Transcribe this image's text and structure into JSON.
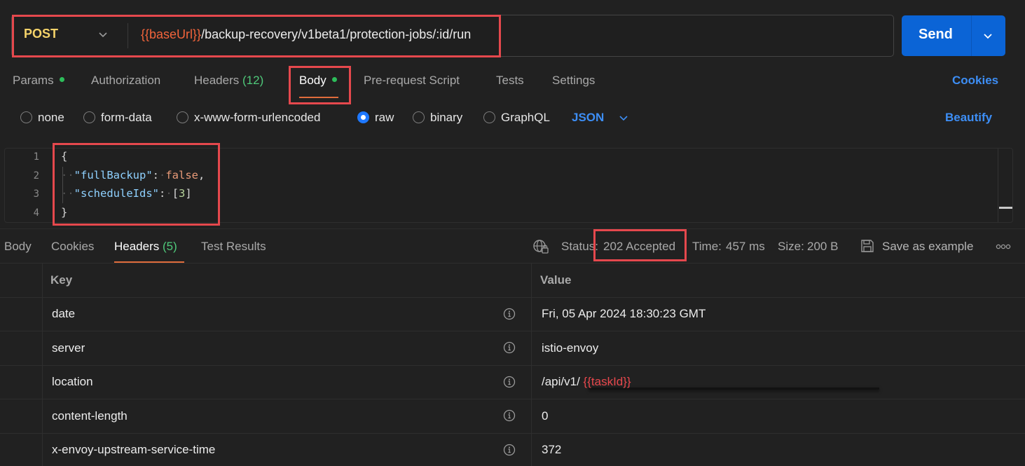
{
  "request": {
    "method": "POST",
    "url_variable": "{{baseUrl}}",
    "url_path": "/backup-recovery/v1beta1/protection-jobs/:id/run",
    "send_label": "Send"
  },
  "request_tabs": [
    {
      "label": "Params",
      "dot": true
    },
    {
      "label": "Authorization"
    },
    {
      "label": "Headers",
      "count": "(12)"
    },
    {
      "label": "Body",
      "dot": true,
      "active": true
    },
    {
      "label": "Pre-request Script"
    },
    {
      "label": "Tests"
    },
    {
      "label": "Settings"
    }
  ],
  "cookies_label": "Cookies",
  "body_modes": {
    "options": [
      "none",
      "form-data",
      "x-www-form-urlencoded",
      "raw",
      "binary",
      "GraphQL"
    ],
    "selected": "raw",
    "format": "JSON",
    "beautify_label": "Beautify"
  },
  "editor": {
    "line_numbers": [
      "1",
      "2",
      "3",
      "4"
    ],
    "lines": {
      "open": "{",
      "key1": "\"fullBackup\"",
      "val1": "false",
      "key2": "\"scheduleIds\"",
      "val2_open": "[",
      "val2_num": "3",
      "val2_close": "]",
      "close": "}"
    }
  },
  "response_tabs": [
    {
      "label": "Body"
    },
    {
      "label": "Cookies"
    },
    {
      "label": "Headers",
      "count": "(5)",
      "active": true
    },
    {
      "label": "Test Results"
    }
  ],
  "response_meta": {
    "status_label": "Status:",
    "status_value": "202 Accepted",
    "time_label": "Time:",
    "time_value": "457 ms",
    "size_label": "Size:",
    "size_value": "200 B",
    "save_label": "Save as example"
  },
  "headers_table": {
    "columns": [
      "Key",
      "Value"
    ],
    "rows": [
      {
        "key": "date",
        "value": "Fri, 05 Apr 2024 18:30:23 GMT"
      },
      {
        "key": "server",
        "value": "istio-envoy"
      },
      {
        "key": "location",
        "value": "/api/v1/ ",
        "value_variable": "{{taskId}}"
      },
      {
        "key": "content-length",
        "value": "0"
      },
      {
        "key": "x-envoy-upstream-service-time",
        "value": "372"
      }
    ]
  },
  "colors": {
    "accent_blue": "#0b64d6",
    "link_blue": "#3d8ef5",
    "method_yellow": "#f5d36a",
    "variable_orange": "#f2643b",
    "success_green": "#4fc97a",
    "tab_underline": "#e06c3c",
    "annotation_red": "#e5484d"
  }
}
